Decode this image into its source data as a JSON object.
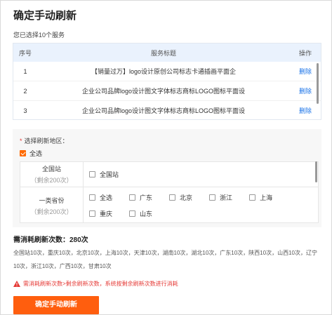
{
  "dialog": {
    "title": "确定手动刷新",
    "selected_text": "您已选择10个服务"
  },
  "table": {
    "headers": [
      "序号",
      "服务标题",
      "操作"
    ],
    "rows": [
      {
        "index": "1",
        "title": "【销量过万】logo设计原创公司标志卡通插画平面企",
        "action": "删除"
      },
      {
        "index": "2",
        "title": "企业公司品牌logo设计图文字体标志商标LOGO图标平面设",
        "action": "删除"
      },
      {
        "index": "3",
        "title": "企业公司品牌logo设计图文字体标志商标LOGO图标平面设",
        "action": "删除"
      }
    ]
  },
  "region": {
    "label": "选择刷新地区：",
    "required_mark": "*",
    "select_all": "全选",
    "select_all_checked": true,
    "groups": [
      {
        "name": "全国站",
        "remaining": "（剩余200次）",
        "options": [
          {
            "label": "全国站",
            "checked": false
          }
        ]
      },
      {
        "name": "一类省份",
        "remaining": "（剩余200次）",
        "options": [
          {
            "label": "全选",
            "checked": false
          },
          {
            "label": "广东",
            "checked": false
          },
          {
            "label": "北京",
            "checked": false
          },
          {
            "label": "浙江",
            "checked": false
          },
          {
            "label": "上海",
            "checked": false
          },
          {
            "label": "重庆",
            "checked": false
          },
          {
            "label": "山东",
            "checked": false
          }
        ]
      }
    ]
  },
  "consume": {
    "label": "需消耗刷新次数：280次",
    "detail": "全国站10次，重庆10次，北京10次，上海10次，天津10次，湖南10次，湖北10次，广东10次，陕西10次，山西10次，辽宁10次，浙江10次，广西10次，甘肃10次"
  },
  "warning": {
    "text": "需消耗刷新次数>剩余刷新次数，系统按剩余刷新次数进行消耗",
    "color": "#e53935"
  },
  "confirm_button": {
    "label": "确定手动刷新",
    "color": "#ff5e0e"
  }
}
